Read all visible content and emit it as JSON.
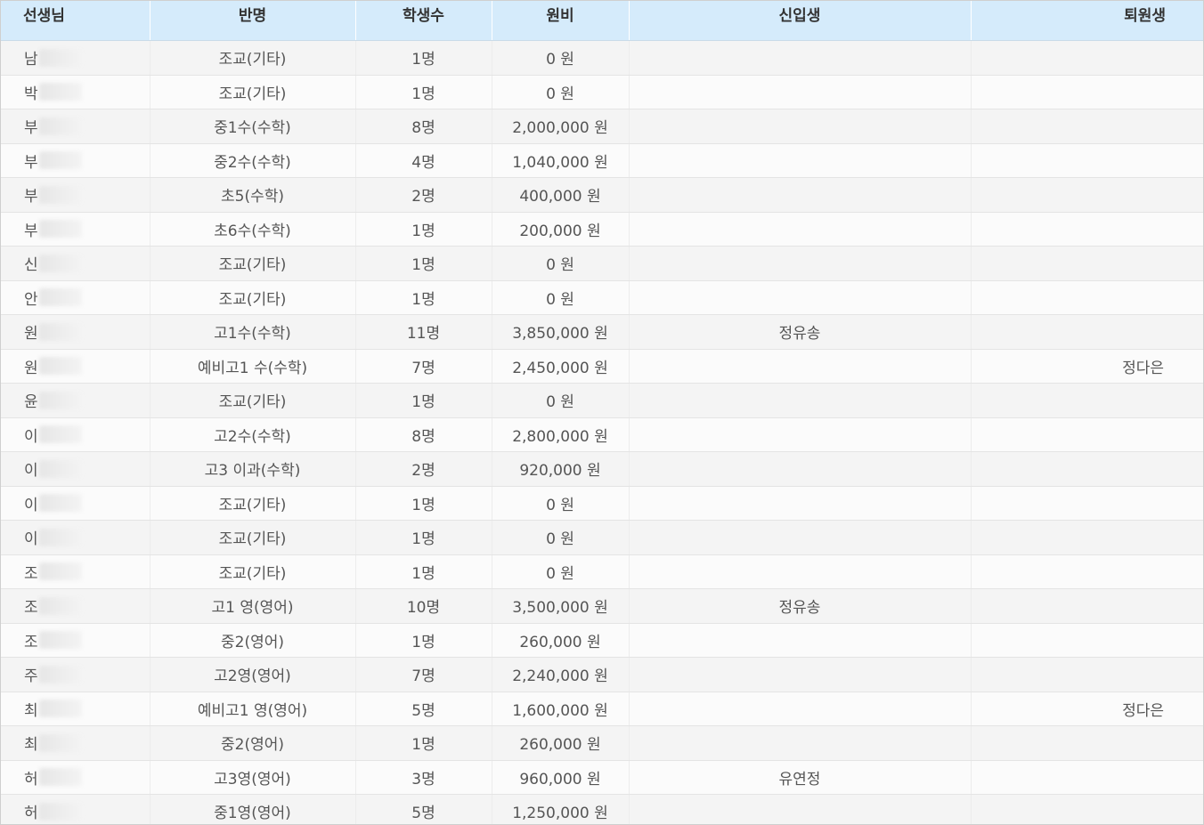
{
  "table": {
    "headers": {
      "teacher": "선생님",
      "class": "반명",
      "students": "학생수",
      "fee": "원비",
      "new": "신입생",
      "leave": "퇴원생"
    },
    "rows": [
      {
        "teacher": "남",
        "class": "조교(기타)",
        "students": "1명",
        "fee": "0 원",
        "new": "",
        "leave": ""
      },
      {
        "teacher": "박",
        "class": "조교(기타)",
        "students": "1명",
        "fee": "0 원",
        "new": "",
        "leave": ""
      },
      {
        "teacher": "부",
        "class": "중1수(수학)",
        "students": "8명",
        "fee": "2,000,000 원",
        "new": "",
        "leave": ""
      },
      {
        "teacher": "부",
        "class": "중2수(수학)",
        "students": "4명",
        "fee": "1,040,000 원",
        "new": "",
        "leave": ""
      },
      {
        "teacher": "부",
        "class": "초5(수학)",
        "students": "2명",
        "fee": "400,000 원",
        "new": "",
        "leave": ""
      },
      {
        "teacher": "부",
        "class": "초6수(수학)",
        "students": "1명",
        "fee": "200,000 원",
        "new": "",
        "leave": ""
      },
      {
        "teacher": "신",
        "class": "조교(기타)",
        "students": "1명",
        "fee": "0 원",
        "new": "",
        "leave": ""
      },
      {
        "teacher": "안",
        "class": "조교(기타)",
        "students": "1명",
        "fee": "0 원",
        "new": "",
        "leave": ""
      },
      {
        "teacher": "원",
        "class": "고1수(수학)",
        "students": "11명",
        "fee": "3,850,000 원",
        "new": "정유송",
        "leave": ""
      },
      {
        "teacher": "원",
        "class": "예비고1 수(수학)",
        "students": "7명",
        "fee": "2,450,000 원",
        "new": "",
        "leave": "정다은"
      },
      {
        "teacher": "윤",
        "class": "조교(기타)",
        "students": "1명",
        "fee": "0 원",
        "new": "",
        "leave": ""
      },
      {
        "teacher": "이",
        "class": "고2수(수학)",
        "students": "8명",
        "fee": "2,800,000 원",
        "new": "",
        "leave": ""
      },
      {
        "teacher": "이",
        "class": "고3 이과(수학)",
        "students": "2명",
        "fee": "920,000 원",
        "new": "",
        "leave": ""
      },
      {
        "teacher": "이",
        "class": "조교(기타)",
        "students": "1명",
        "fee": "0 원",
        "new": "",
        "leave": ""
      },
      {
        "teacher": "이",
        "class": "조교(기타)",
        "students": "1명",
        "fee": "0 원",
        "new": "",
        "leave": ""
      },
      {
        "teacher": "조",
        "class": "조교(기타)",
        "students": "1명",
        "fee": "0 원",
        "new": "",
        "leave": ""
      },
      {
        "teacher": "조",
        "class": "고1 영(영어)",
        "students": "10명",
        "fee": "3,500,000 원",
        "new": "정유송",
        "leave": ""
      },
      {
        "teacher": "조",
        "class": "중2(영어)",
        "students": "1명",
        "fee": "260,000 원",
        "new": "",
        "leave": ""
      },
      {
        "teacher": "주",
        "class": "고2영(영어)",
        "students": "7명",
        "fee": "2,240,000 원",
        "new": "",
        "leave": ""
      },
      {
        "teacher": "최",
        "class": "예비고1 영(영어)",
        "students": "5명",
        "fee": "1,600,000 원",
        "new": "",
        "leave": "정다은"
      },
      {
        "teacher": "최",
        "class": "중2(영어)",
        "students": "1명",
        "fee": "260,000 원",
        "new": "",
        "leave": ""
      },
      {
        "teacher": "허",
        "class": "고3영(영어)",
        "students": "3명",
        "fee": "960,000 원",
        "new": "유연정",
        "leave": ""
      },
      {
        "teacher": "허",
        "class": "중1영(영어)",
        "students": "5명",
        "fee": "1,250,000 원",
        "new": "",
        "leave": ""
      }
    ]
  }
}
